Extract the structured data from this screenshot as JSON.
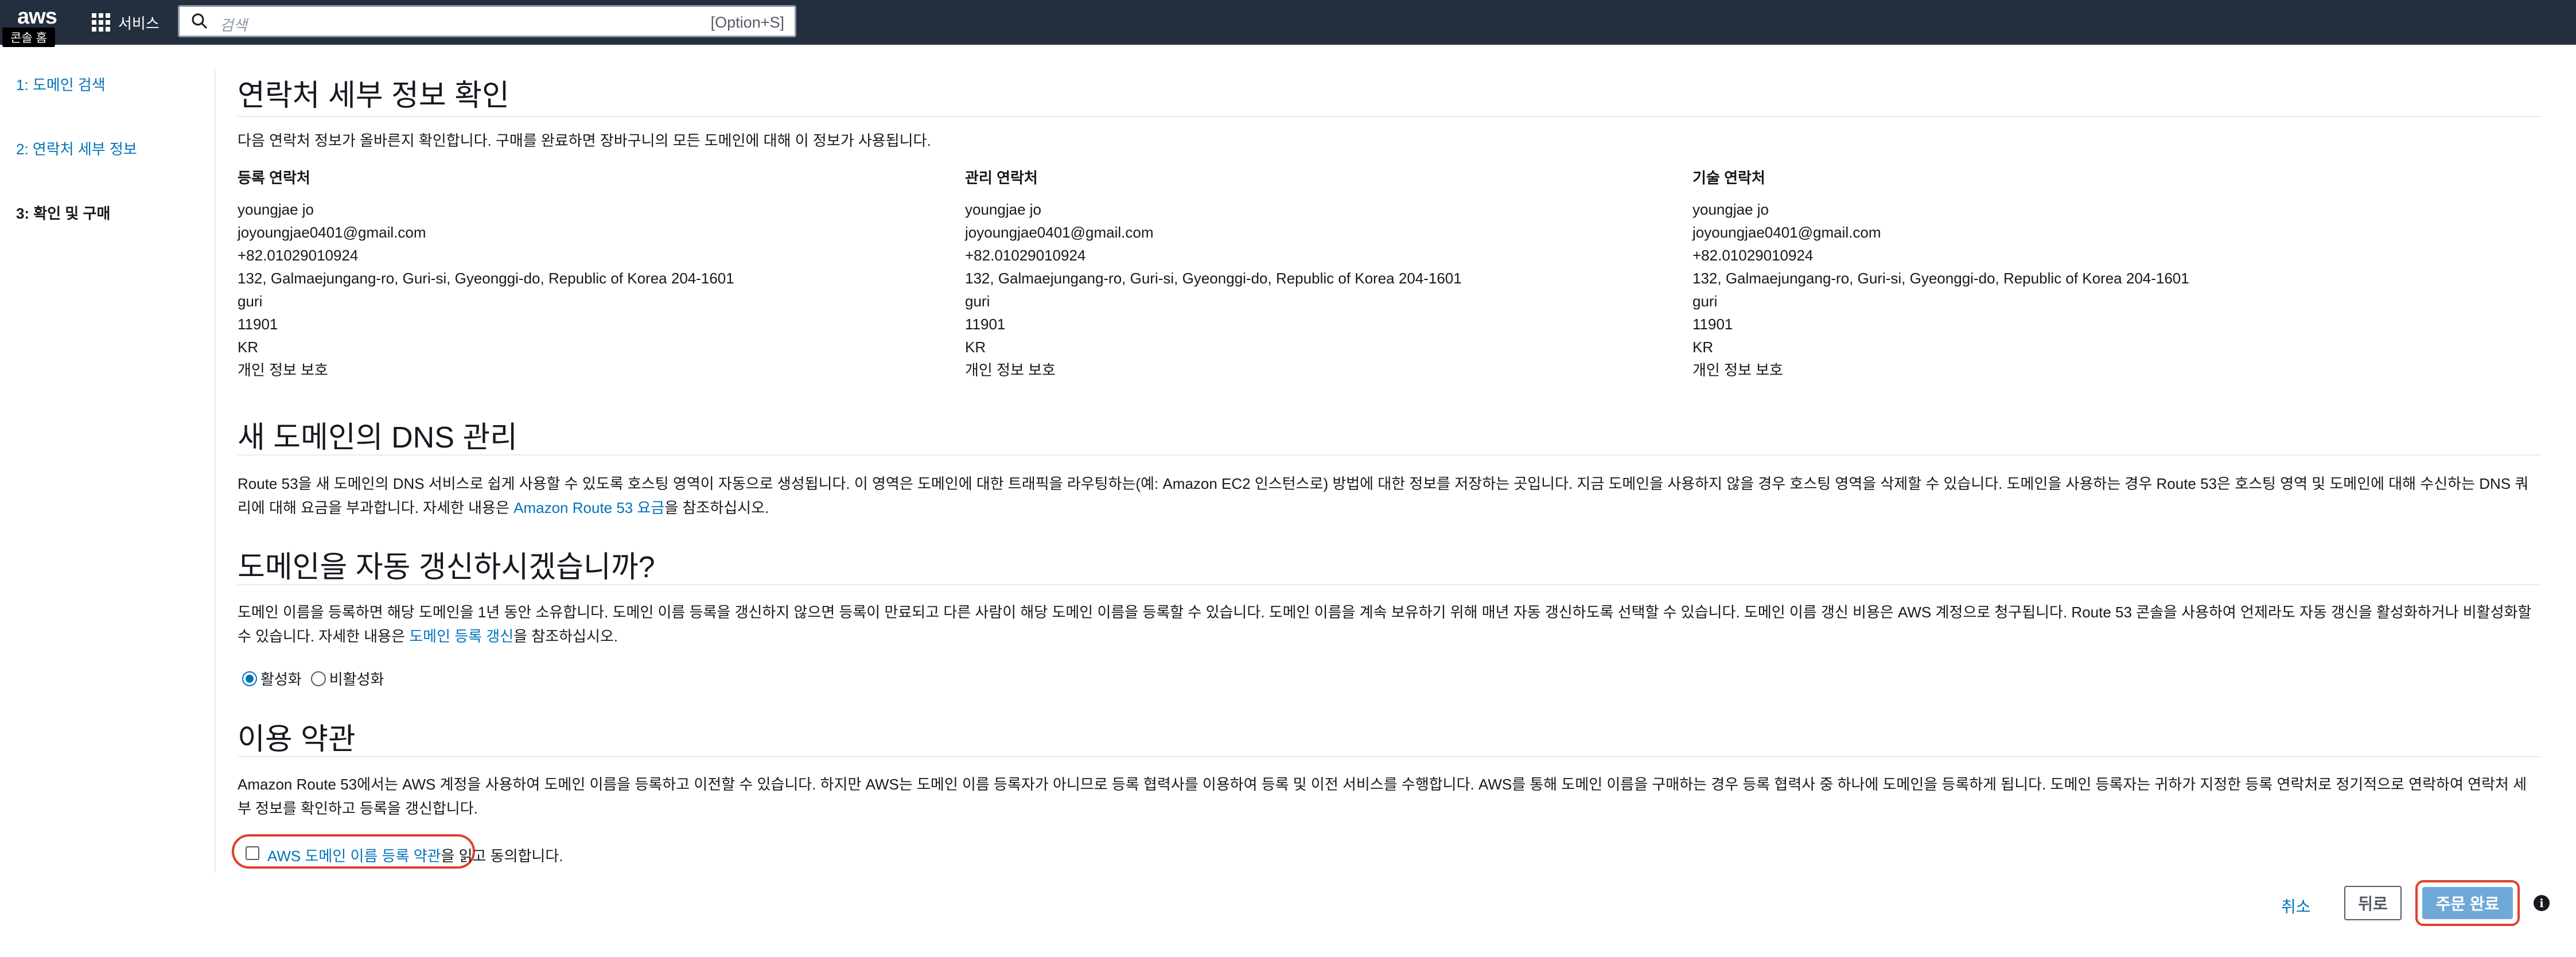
{
  "topnav": {
    "logo": "aws",
    "home_tooltip": "콘솔 홈",
    "services_label": "서비스",
    "search_placeholder": "검색",
    "search_shortcut": "[Option+S]"
  },
  "steps": [
    {
      "label": "1: 도메인 검색"
    },
    {
      "label": "2: 연락처 세부 정보"
    },
    {
      "label": "3: 확인 및 구매"
    }
  ],
  "contacts": {
    "heading": "연락처 세부 정보 확인",
    "intro": "다음 연락처 정보가 올바른지 확인합니다. 구매를 완료하면 장바구니의 모든 도메인에 대해 이 정보가 사용됩니다.",
    "columns": [
      {
        "title": "등록 연락처",
        "lines": [
          "youngjae jo",
          "joyoungjae0401@gmail.com",
          "+82.01029010924",
          "132, Galmaejungang-ro, Guri-si, Gyeonggi-do, Republic of Korea 204-1601",
          "guri",
          "11901",
          "KR",
          "개인 정보 보호"
        ]
      },
      {
        "title": "관리 연락처",
        "lines": [
          "youngjae jo",
          "joyoungjae0401@gmail.com",
          "+82.01029010924",
          "132, Galmaejungang-ro, Guri-si, Gyeonggi-do, Republic of Korea 204-1601",
          "guri",
          "11901",
          "KR",
          "개인 정보 보호"
        ]
      },
      {
        "title": "기술 연락처",
        "lines": [
          "youngjae jo",
          "joyoungjae0401@gmail.com",
          "+82.01029010924",
          "132, Galmaejungang-ro, Guri-si, Gyeonggi-do, Republic of Korea 204-1601",
          "guri",
          "11901",
          "KR",
          "개인 정보 보호"
        ]
      }
    ]
  },
  "dns": {
    "heading": "새 도메인의 DNS 관리",
    "text_before": "Route 53을 새 도메인의 DNS 서비스로 쉽게 사용할 수 있도록 호스팅 영역이 자동으로 생성됩니다. 이 영역은 도메인에 대한 트래픽을 라우팅하는(예: Amazon EC2 인스턴스로) 방법에 대한 정보를 저장하는 곳입니다. 지금 도메인을 사용하지 않을 경우 호스팅 영역을 삭제할 수 있습니다. 도메인을 사용하는 경우 Route 53은 호스팅 영역 및 도메인에 대해 수신하는 DNS 쿼리에 대해 요금을 부과합니다. 자세한 내용은 ",
    "link": "Amazon Route 53 요금",
    "text_after": "을 참조하십시오."
  },
  "renew": {
    "heading": "도메인을 자동 갱신하시겠습니까?",
    "text_before": "도메인 이름을 등록하면 해당 도메인을 1년 동안 소유합니다. 도메인 이름 등록을 갱신하지 않으면 등록이 만료되고 다른 사람이 해당 도메인 이름을 등록할 수 있습니다. 도메인 이름을 계속 보유하기 위해 매년 자동 갱신하도록 선택할 수 있습니다. 도메인 이름 갱신 비용은 AWS 계정으로 청구됩니다. Route 53 콘솔을 사용하여 언제라도 자동 갱신을 활성화하거나 비활성화할 수 있습니다. 자세한 내용은 ",
    "link": "도메인 등록 갱신",
    "text_after": "을 참조하십시오.",
    "enable_label": "활성화",
    "disable_label": "비활성화",
    "selected": "활성화"
  },
  "terms": {
    "heading": "이용 약관",
    "text": "Amazon Route 53에서는 AWS 계정을 사용하여 도메인 이름을 등록하고 이전할 수 있습니다. 하지만 AWS는 도메인 이름 등록자가 아니므로 등록 협력사를 이용하여 등록 및 이전 서비스를 수행합니다. AWS를 통해 도메인 이름을 구매하는 경우 등록 협력사 중 하나에 도메인을 등록하게 됩니다. 도메인 등록자는 귀하가 지정한 등록 연락처로 정기적으로 연락하여 연락처 세부 정보를 확인하고 등록을 갱신합니다.",
    "agree_link": "AWS 도메인 이름 등록 약관",
    "agree_suffix": "을 읽고 동의합니다.",
    "agreed": false
  },
  "footer": {
    "cancel_label": "취소",
    "back_label": "뒤로",
    "submit_label": "주문 완료"
  },
  "colors": {
    "nav_bg": "#232f3e",
    "link": "#0073bb",
    "highlight_ring": "#e0402a",
    "submit_bg": "#6fa9d8"
  }
}
